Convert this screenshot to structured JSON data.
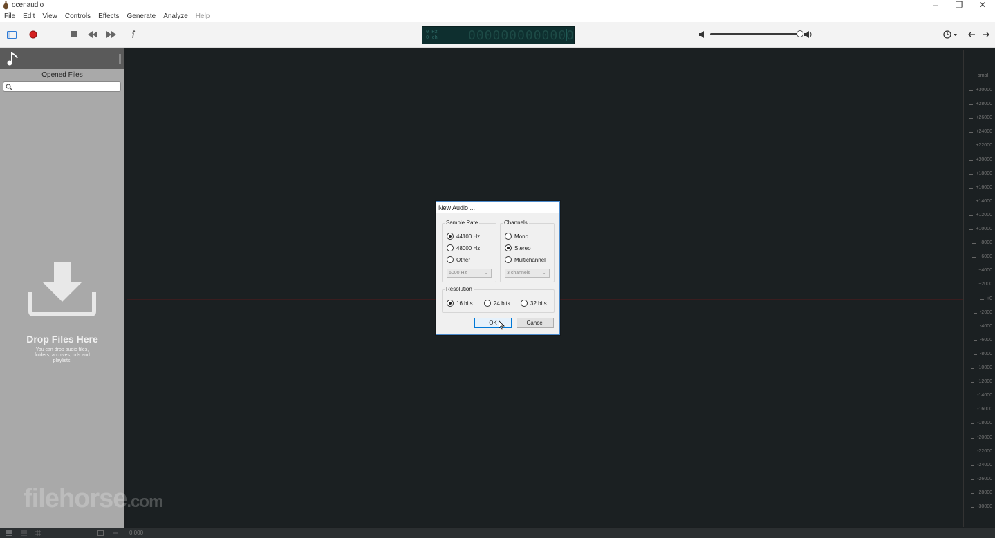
{
  "window": {
    "title": "ocenaudio"
  },
  "menu": [
    "File",
    "Edit",
    "View",
    "Controls",
    "Effects",
    "Generate",
    "Analyze",
    "Help"
  ],
  "menu_disabled": [
    "Help"
  ],
  "lcd": {
    "freq": "0 Hz",
    "channels": "0 ch",
    "digits": "0000000000000"
  },
  "sidebar": {
    "title": "Opened Files",
    "search_placeholder": "",
    "drop_title": "Drop Files Here",
    "drop_subtitle": "You can drop audio files, folders, archives, urls and playlists."
  },
  "ruler": {
    "unit": "smpl",
    "ticks": [
      "+30000",
      "+28000",
      "+26000",
      "+24000",
      "+22000",
      "+20000",
      "+18000",
      "+16000",
      "+14000",
      "+12000",
      "+10000",
      "+8000",
      "+6000",
      "+4000",
      "+2000",
      "+0",
      "-2000",
      "-4000",
      "-6000",
      "-8000",
      "-10000",
      "-12000",
      "-14000",
      "-16000",
      "-18000",
      "-20000",
      "-22000",
      "-24000",
      "-26000",
      "-28000",
      "-30000"
    ]
  },
  "status": {
    "time": "0.000"
  },
  "watermark": {
    "main": "filehorse",
    "suffix": ".com"
  },
  "dialog": {
    "title": "New Audio ...",
    "sample_rate": {
      "label": "Sample Rate",
      "options": [
        "44100 Hz",
        "48000 Hz",
        "Other"
      ],
      "selected": "44100 Hz",
      "other_value": "6000 Hz"
    },
    "channels": {
      "label": "Channels",
      "options": [
        "Mono",
        "Stereo",
        "Multichannel"
      ],
      "selected": "Stereo",
      "multi_value": "3 channels"
    },
    "resolution": {
      "label": "Resolution",
      "options": [
        "16 bits",
        "24 bits",
        "32 bits"
      ],
      "selected": "16 bits"
    },
    "ok_label": "OK",
    "cancel_label": "Cancel"
  },
  "colors": {
    "background": "#1b2022",
    "sidebar": "#a9a9a9",
    "lcd": "#0e2f2f",
    "record": "#d42020",
    "accent": "#2f7bd6"
  }
}
